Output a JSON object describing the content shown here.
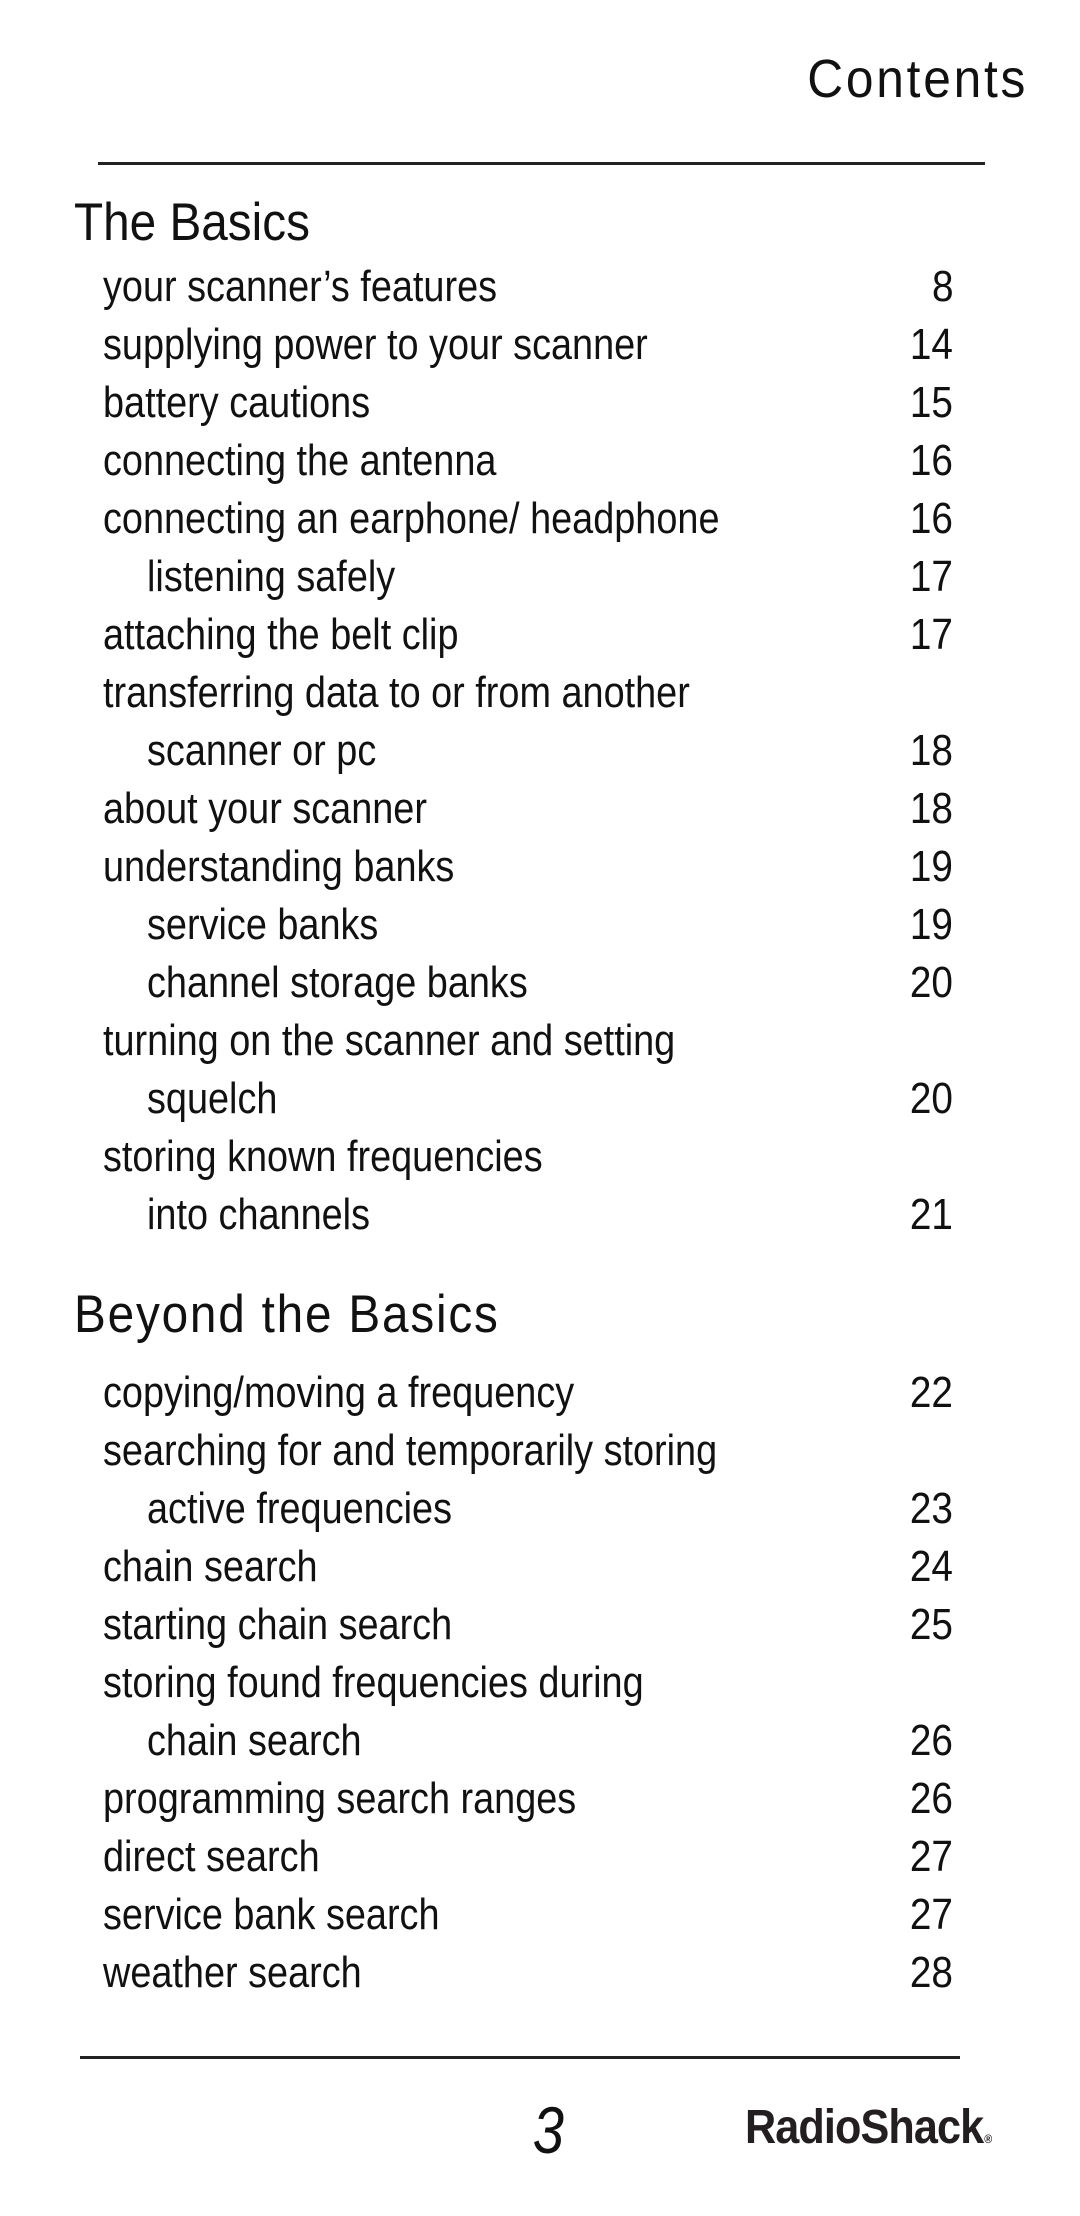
{
  "page": {
    "heading": "Contents",
    "page_number": "3",
    "brand": "RadioShack",
    "brand_mark": "®"
  },
  "sections": [
    {
      "title": "The Basics",
      "entries": [
        {
          "text": "your scanner’s features",
          "page": "8",
          "indent": false
        },
        {
          "text": "supplying power to your scanner",
          "page": "14",
          "indent": false
        },
        {
          "text": "battery cautions",
          "page": "15",
          "indent": false
        },
        {
          "text": "connecting the antenna",
          "page": "16",
          "indent": false
        },
        {
          "text": "connecting an earphone/ headphone",
          "page": "16",
          "indent": false
        },
        {
          "text": "listening safely",
          "page": "17",
          "indent": true
        },
        {
          "text": "attaching the belt clip",
          "page": "17",
          "indent": false
        },
        {
          "text": "transferring data to or from another",
          "page": "",
          "indent": false
        },
        {
          "text": "scanner or pc",
          "page": "18",
          "indent": true
        },
        {
          "text": "about your scanner",
          "page": "18",
          "indent": false
        },
        {
          "text": "understanding banks",
          "page": "19",
          "indent": false
        },
        {
          "text": "service banks",
          "page": "19",
          "indent": true
        },
        {
          "text": "channel storage banks",
          "page": "20",
          "indent": true
        },
        {
          "text": "turning on the scanner and setting",
          "page": "",
          "indent": false
        },
        {
          "text": "squelch",
          "page": "20",
          "indent": true
        },
        {
          "text": "storing known frequencies",
          "page": "",
          "indent": false
        },
        {
          "text": "into channels",
          "page": "21",
          "indent": true
        }
      ]
    },
    {
      "title": "Beyond the Basics",
      "entries": [
        {
          "text": "copying/moving a frequency",
          "page": "22",
          "indent": false
        },
        {
          "text": "searching for and temporarily storing",
          "page": "",
          "indent": false
        },
        {
          "text": "active frequencies",
          "page": "23",
          "indent": true
        },
        {
          "text": "chain search",
          "page": "24",
          "indent": false
        },
        {
          "text": "starting chain search",
          "page": "25",
          "indent": false
        },
        {
          "text": "storing found frequencies during",
          "page": "",
          "indent": false
        },
        {
          "text": "chain search",
          "page": "26",
          "indent": true
        },
        {
          "text": "programming search ranges",
          "page": "26",
          "indent": false
        },
        {
          "text": "direct search",
          "page": "27",
          "indent": false
        },
        {
          "text": "service bank search",
          "page": "27",
          "indent": false
        },
        {
          "text": "weather search",
          "page": "28",
          "indent": false
        }
      ]
    }
  ]
}
